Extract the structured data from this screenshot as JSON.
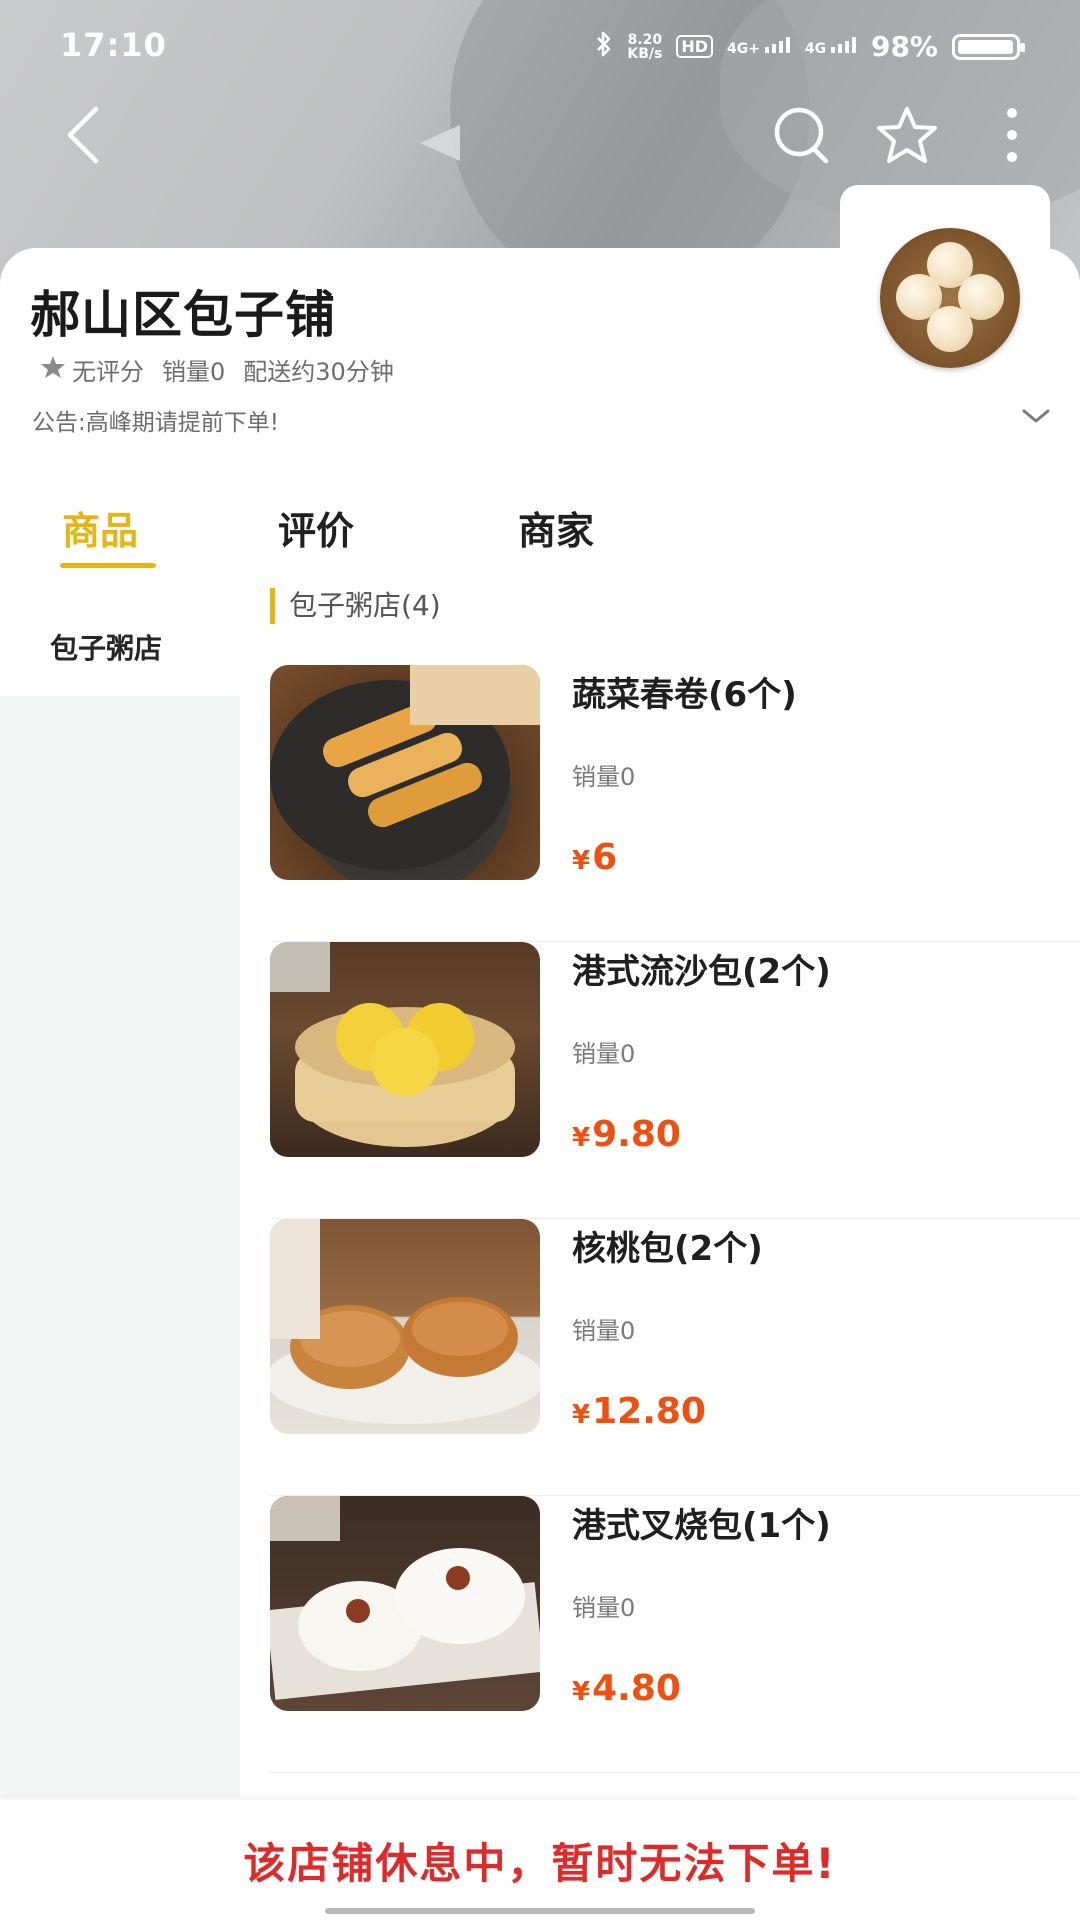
{
  "status_bar": {
    "time": "17:10",
    "net_speed_value": "8.20",
    "net_speed_unit": "KB/s",
    "hd_label": "HD",
    "signal_label": "4G+",
    "signal_label_2": "4G",
    "battery_text": "98%",
    "battery_level": 0.98
  },
  "header": {
    "back_icon": "chevron-left-icon",
    "search_icon": "search-icon",
    "favorite_icon": "star-outline-icon",
    "more_icon": "more-vertical-icon"
  },
  "shop": {
    "name": "郝山区包子铺",
    "rating": "无评分",
    "sales": "销量0",
    "delivery": "配送约30分钟",
    "notice": "公告:高峰期请提前下单!"
  },
  "tabs": [
    {
      "label": "商品",
      "active": true
    },
    {
      "label": "评价",
      "active": false
    },
    {
      "label": "商家",
      "active": false
    }
  ],
  "sidebar": {
    "items": [
      {
        "label": "包子粥店",
        "active": true
      }
    ]
  },
  "section": {
    "title": "包子粥店(4)"
  },
  "products": [
    {
      "name": "蔬菜春卷(6个)",
      "sales": "销量0",
      "currency": "¥",
      "price": "6"
    },
    {
      "name": "港式流沙包(2个)",
      "sales": "销量0",
      "currency": "¥",
      "price": "9.80"
    },
    {
      "name": "核桃包(2个)",
      "sales": "销量0",
      "currency": "¥",
      "price": "12.80"
    },
    {
      "name": "港式叉烧包(1个)",
      "sales": "销量0",
      "currency": "¥",
      "price": "4.80"
    }
  ],
  "bottom_bar": {
    "message": "该店铺休息中，暂时无法下单!"
  },
  "colors": {
    "accent": "#e8b40f",
    "price": "#f0500f",
    "closed_message": "#e02a2a"
  }
}
